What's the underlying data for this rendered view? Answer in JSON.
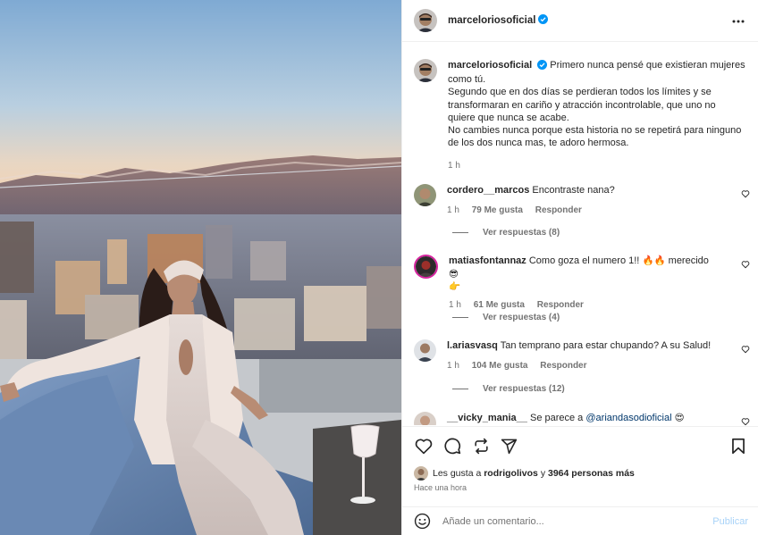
{
  "header": {
    "username": "marceloriosoficial",
    "more_icon": "more-horizontal-icon",
    "verified_color": "#0095f6"
  },
  "caption": {
    "username": "marceloriosoficial",
    "text_lines": [
      "Primero nunca pensé que existieran mujeres",
      "como tú.",
      "Segundo que en dos días se perdieran todos los límites y se",
      "transformaran en cariño y atracción incontrolable, que uno no",
      "quiere que nunca se acabe.",
      "No cambies nunca porque esta historia no se repetirá para ninguno",
      "de los dos nunca mas, te adoro hermosa."
    ],
    "time": "1 h"
  },
  "comments": [
    {
      "username": "cordero__marcos",
      "text": "Encontraste nana?",
      "time": "1 h",
      "likes": "79 Me gusta",
      "reply": "Responder",
      "view_replies": "Ver respuestas (8)"
    },
    {
      "username": "matiasfontannaz",
      "text": "Como goza el numero 1!!",
      "emoji_a": "🔥🔥",
      "text_b": "merecido",
      "emoji_b": "😎",
      "emoji_c": "👉",
      "time": "1 h",
      "likes": "61 Me gusta",
      "reply": "Responder",
      "view_replies": "Ver respuestas (4)"
    },
    {
      "username": "l.ariasvasq",
      "text": "Tan temprano para estar chupando? A su Salud!",
      "time": "1 h",
      "likes": "104 Me gusta",
      "reply": "Responder",
      "view_replies": "Ver respuestas (12)"
    },
    {
      "username": "__vicky_mania__",
      "text": "Se parece a",
      "mention": "@ariandasodioficial",
      "emoji": "😍"
    }
  ],
  "actions": {
    "like_icon": "heart-icon",
    "comment_icon": "comment-icon",
    "share_icon": "repost-icon",
    "send_icon": "send-icon",
    "save_icon": "bookmark-icon"
  },
  "likes": {
    "prefix": "Les gusta a",
    "user": "rodrigolivos",
    "joiner": "y",
    "others": "3964 personas más"
  },
  "posted": "Hace una hora",
  "add_comment": {
    "emoji_icon": "emoji-icon",
    "placeholder": "Añade un comentario...",
    "publish": "Publicar",
    "publish_color": "#a8d3f8"
  }
}
